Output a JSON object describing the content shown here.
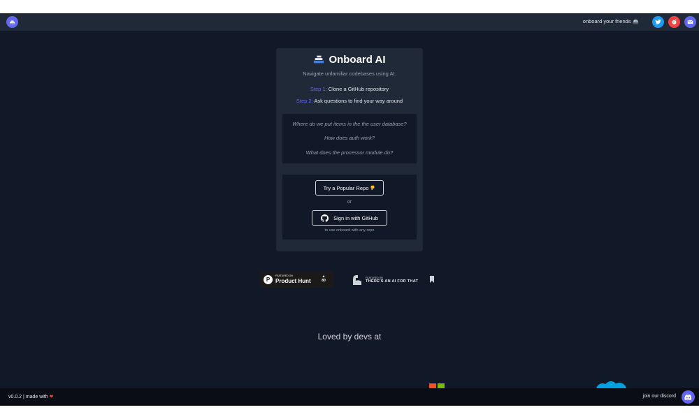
{
  "topbar": {
    "share_text": "onboard your friends 🚢",
    "social": [
      "twitter-icon",
      "reddit-icon",
      "email-icon"
    ]
  },
  "card": {
    "title": "Onboard AI",
    "subtitle": "Navigate unfamiliar codebases using AI.",
    "step1_label": "Step 1:",
    "step1_text": "Clone a GitHub repository",
    "step2_label": "Step 2:",
    "step2_text": "Ask questions to find your way around",
    "examples": [
      "Where do we put items in the the user database?",
      "How does auth work?",
      "What does the processor module do?"
    ],
    "popular_button": "Try a Popular Repo",
    "or_text": "or",
    "github_button": "Sign in with GitHub",
    "github_hint": "to use onboard with any repo"
  },
  "badges": {
    "producthunt_featured": "FEATURED ON",
    "producthunt_name": "Product Hunt",
    "producthunt_count": "80",
    "aift_featured": "FEATURED ON",
    "aift_name": "THERE'S AN AI FOR THAT"
  },
  "loved_by": "Loved by devs at",
  "footer": {
    "version": "v0.0.2 | made with",
    "discord_text": "join our discord"
  },
  "colors": {
    "background": "#111827",
    "panel": "#1f2937",
    "accent": "#6366f1"
  }
}
